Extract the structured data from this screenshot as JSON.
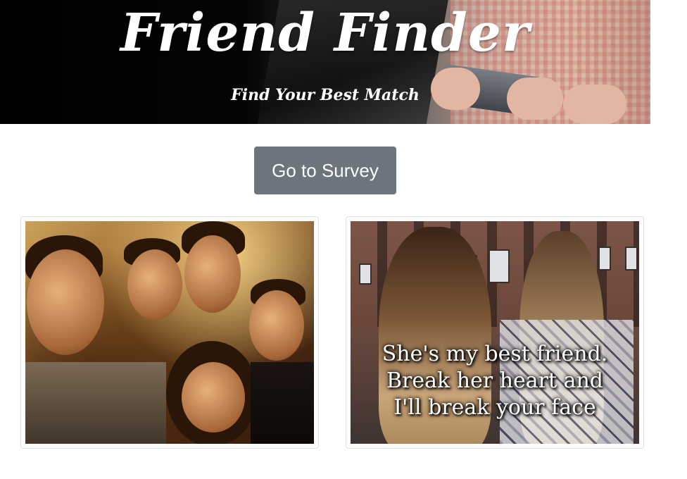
{
  "header": {
    "title": "Friend Finder",
    "subtitle": "Find Your Best Match"
  },
  "survey_button": {
    "label": "Go to Survey",
    "color": "#6c757d"
  },
  "cards": [
    {
      "image_icon": "friends-selfie-photo",
      "caption": ""
    },
    {
      "image_icon": "best-friends-photo",
      "caption": "She's my best friend.\nBreak her heart and\nI'll break your face"
    }
  ],
  "quote_lines": [
    "She's my best friend.",
    "Break her heart and",
    "I'll break your face"
  ]
}
